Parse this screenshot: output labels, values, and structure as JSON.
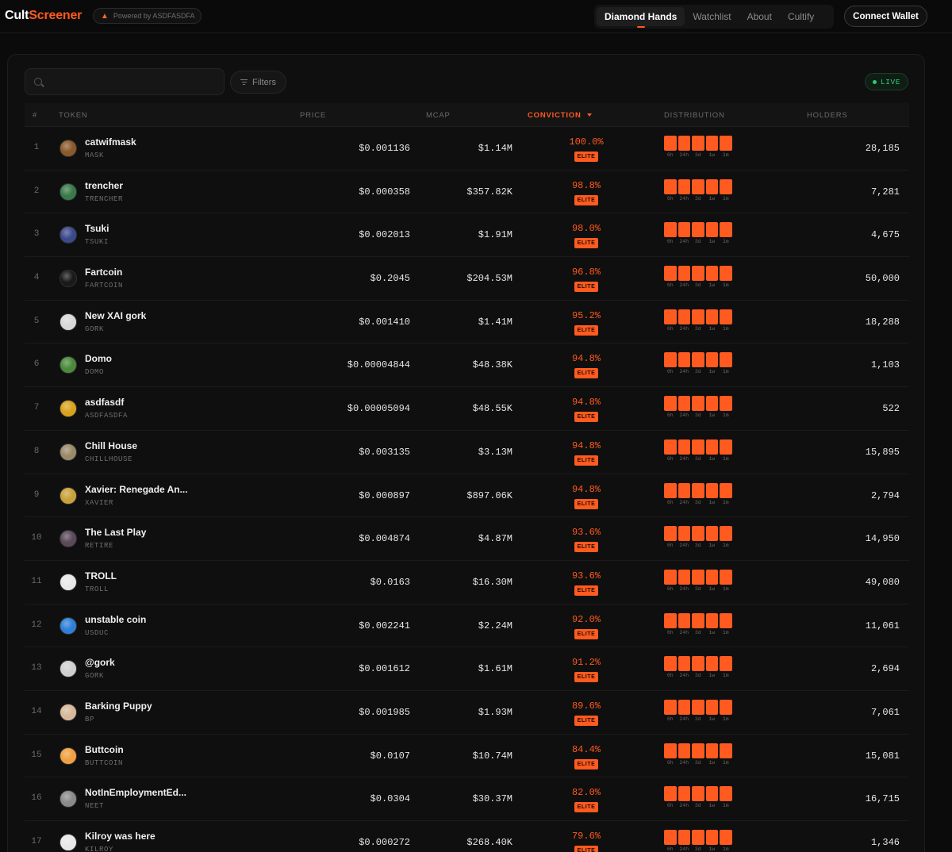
{
  "brand": {
    "part1": "Cult",
    "part2": "Screener",
    "powered_by": "Powered by ASDFASDFA"
  },
  "nav": {
    "tabs": [
      {
        "label": "Diamond Hands",
        "active": true
      },
      {
        "label": "Watchlist",
        "active": false
      },
      {
        "label": "About",
        "active": false
      },
      {
        "label": "Cultify",
        "active": false
      }
    ],
    "connect_label": "Connect Wallet"
  },
  "toolbar": {
    "search_placeholder": "",
    "filters_label": "Filters",
    "live_label": "LIVE"
  },
  "table": {
    "columns": {
      "rank": "#",
      "token": "TOKEN",
      "price": "PRICE",
      "mcap": "MCAP",
      "conviction": "CONVICTION",
      "distribution": "DISTRIBUTION",
      "holders": "HOLDERS"
    },
    "sort": {
      "column": "conviction",
      "direction": "desc"
    },
    "distribution_periods": [
      "6h",
      "24h",
      "3d",
      "1w",
      "1m"
    ],
    "rows": [
      {
        "rank": "1",
        "name": "catwifmask",
        "symbol": "MASK",
        "price": "$0.001136",
        "mcap": "$1.14M",
        "conviction": "100.0%",
        "tier": "ELITE",
        "holders": "28,185",
        "avatar": "#8a5a2b"
      },
      {
        "rank": "2",
        "name": "trencher",
        "symbol": "TRENCHER",
        "price": "$0.000358",
        "mcap": "$357.82K",
        "conviction": "98.8%",
        "tier": "ELITE",
        "holders": "7,281",
        "avatar": "#3a7a4a"
      },
      {
        "rank": "3",
        "name": "Tsuki",
        "symbol": "TSUKI",
        "price": "$0.002013",
        "mcap": "$1.91M",
        "conviction": "98.0%",
        "tier": "ELITE",
        "holders": "4,675",
        "avatar": "#3b4a8c"
      },
      {
        "rank": "4",
        "name": "Fartcoin",
        "symbol": "FARTCOIN",
        "price": "$0.2045",
        "mcap": "$204.53M",
        "conviction": "96.8%",
        "tier": "ELITE",
        "holders": "50,000",
        "avatar": "#1a1a1a"
      },
      {
        "rank": "5",
        "name": "New XAI gork",
        "symbol": "GORK",
        "price": "$0.001410",
        "mcap": "$1.41M",
        "conviction": "95.2%",
        "tier": "ELITE",
        "holders": "18,288",
        "avatar": "#d8d8d8"
      },
      {
        "rank": "6",
        "name": "Domo",
        "symbol": "DOMO",
        "price": "$0.00004844",
        "mcap": "$48.38K",
        "conviction": "94.8%",
        "tier": "ELITE",
        "holders": "1,103",
        "avatar": "#4a8a3a"
      },
      {
        "rank": "7",
        "name": "asdfasdf",
        "symbol": "ASDFASDFA",
        "price": "$0.00005094",
        "mcap": "$48.55K",
        "conviction": "94.8%",
        "tier": "ELITE",
        "holders": "522",
        "avatar": "#d9a21c"
      },
      {
        "rank": "8",
        "name": "Chill House",
        "symbol": "CHILLHOUSE",
        "price": "$0.003135",
        "mcap": "$3.13M",
        "conviction": "94.8%",
        "tier": "ELITE",
        "holders": "15,895",
        "avatar": "#9a8a6a"
      },
      {
        "rank": "9",
        "name": "Xavier: Renegade An...",
        "symbol": "XAVIER",
        "price": "$0.000897",
        "mcap": "$897.06K",
        "conviction": "94.8%",
        "tier": "ELITE",
        "holders": "2,794",
        "avatar": "#c9a13a"
      },
      {
        "rank": "10",
        "name": "The Last Play",
        "symbol": "RETIRE",
        "price": "$0.004874",
        "mcap": "$4.87M",
        "conviction": "93.6%",
        "tier": "ELITE",
        "holders": "14,950",
        "avatar": "#5a4a5a"
      },
      {
        "rank": "11",
        "name": "TROLL",
        "symbol": "TROLL",
        "price": "$0.0163",
        "mcap": "$16.30M",
        "conviction": "93.6%",
        "tier": "ELITE",
        "holders": "49,080",
        "avatar": "#e8e8e8"
      },
      {
        "rank": "12",
        "name": "unstable coin",
        "symbol": "USDUC",
        "price": "$0.002241",
        "mcap": "$2.24M",
        "conviction": "92.0%",
        "tier": "ELITE",
        "holders": "11,061",
        "avatar": "#2f7fd8"
      },
      {
        "rank": "13",
        "name": "@gork",
        "symbol": "GORK",
        "price": "$0.001612",
        "mcap": "$1.61M",
        "conviction": "91.2%",
        "tier": "ELITE",
        "holders": "2,694",
        "avatar": "#cfcfcf"
      },
      {
        "rank": "14",
        "name": "Barking Puppy",
        "symbol": "BP",
        "price": "$0.001985",
        "mcap": "$1.93M",
        "conviction": "89.6%",
        "tier": "ELITE",
        "holders": "7,061",
        "avatar": "#d8b89a"
      },
      {
        "rank": "15",
        "name": "Buttcoin",
        "symbol": "BUTTCOIN",
        "price": "$0.0107",
        "mcap": "$10.74M",
        "conviction": "84.4%",
        "tier": "ELITE",
        "holders": "15,081",
        "avatar": "#f0a040"
      },
      {
        "rank": "16",
        "name": "NotInEmploymentEd...",
        "symbol": "NEET",
        "price": "$0.0304",
        "mcap": "$30.37M",
        "conviction": "82.0%",
        "tier": "ELITE",
        "holders": "16,715",
        "avatar": "#8a8a8a"
      },
      {
        "rank": "17",
        "name": "Kilroy was here",
        "symbol": "KILROY",
        "price": "$0.000272",
        "mcap": "$268.40K",
        "conviction": "79.6%",
        "tier": "ELITE",
        "holders": "1,346",
        "avatar": "#e8e8e8"
      }
    ]
  },
  "colors": {
    "accent": "#ff5a1f",
    "live": "#2ecc71",
    "background": "#0b0b0b"
  }
}
